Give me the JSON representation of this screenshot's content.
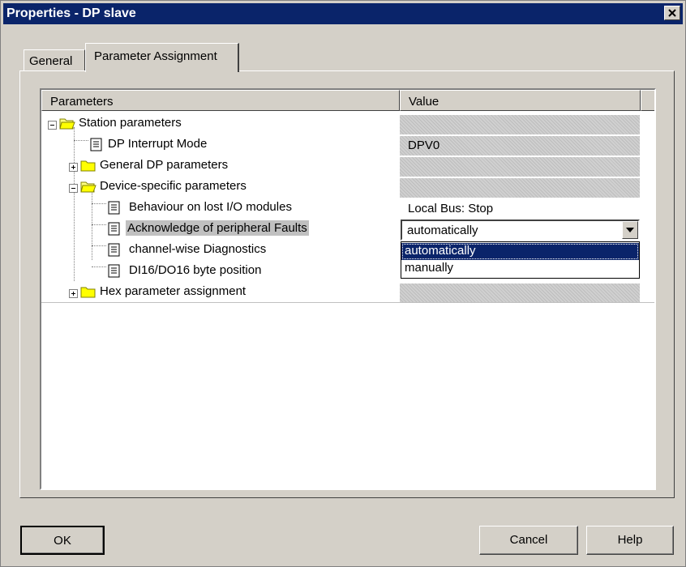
{
  "window": {
    "title": "Properties - DP slave"
  },
  "tabs": [
    {
      "label": "General",
      "active": false
    },
    {
      "label": "Parameter Assignment",
      "active": true
    }
  ],
  "table": {
    "columns": [
      "Parameters",
      "Value"
    ],
    "rows": [
      {
        "label": "Station parameters",
        "type": "folder",
        "expanded": true,
        "value": ""
      },
      {
        "label": "DP Interrupt Mode",
        "type": "param",
        "value": "DPV0"
      },
      {
        "label": "General DP parameters",
        "type": "folder",
        "expanded": false,
        "value": ""
      },
      {
        "label": "Device-specific parameters",
        "type": "folder",
        "expanded": true,
        "value": ""
      },
      {
        "label": "Behaviour on lost I/O modules",
        "type": "param",
        "value": "Local Bus: Stop"
      },
      {
        "label": "Acknowledge of peripheral Faults",
        "type": "param",
        "selected": true,
        "value": "automatically"
      },
      {
        "label": "channel-wise Diagnostics",
        "type": "param",
        "value": ""
      },
      {
        "label": "DI16/DO16 byte position",
        "type": "param",
        "value": ""
      },
      {
        "label": "Hex parameter assignment",
        "type": "folder",
        "expanded": false,
        "value": ""
      }
    ]
  },
  "dropdown": {
    "options": [
      "automatically",
      "manually"
    ],
    "selected": "automatically"
  },
  "buttons": {
    "ok": "OK",
    "cancel": "Cancel",
    "help": "Help"
  },
  "colors": {
    "titlebar": "#0a246a",
    "face": "#d4d0c8",
    "selection": "#0a246a"
  },
  "icons": [
    "folder-open-icon",
    "folder-closed-icon",
    "document-icon",
    "close-icon",
    "dropdown-arrow-icon"
  ]
}
